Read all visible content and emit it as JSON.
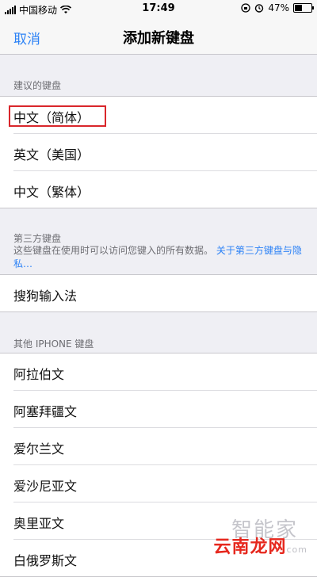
{
  "status_bar": {
    "carrier": "中国移动",
    "time": "17:49",
    "battery_percent": "47%",
    "battery_level": 0.47,
    "icons": [
      "signal-icon",
      "wifi-icon",
      "rotation-lock-icon",
      "alarm-icon",
      "battery-icon"
    ]
  },
  "nav": {
    "cancel_label": "取消",
    "title": "添加新键盘"
  },
  "sections": {
    "suggested": {
      "header": "建议的键盘",
      "items": [
        "中文（简体）",
        "英文（美国）",
        "中文（繁体）"
      ]
    },
    "third_party": {
      "header": "第三方键盘",
      "footer_text": "这些键盘在使用时可以访问您键入的所有数据。",
      "footer_link": "关于第三方键盘与隐私…",
      "items": [
        "搜狗输入法"
      ]
    },
    "other": {
      "header": "其他 IPHONE 键盘",
      "items": [
        "阿拉伯文",
        "阿塞拜疆文",
        "爱尔兰文",
        "爱沙尼亚文",
        "奥里亚文",
        "白俄罗斯文"
      ]
    }
  },
  "annotation": {
    "highlight_color": "#d9262b"
  },
  "watermark": {
    "top": "智能家",
    "bottom": "云南龙网",
    "suffix": "com"
  },
  "colors": {
    "accent": "#2c82f6",
    "background": "#efeff4"
  }
}
